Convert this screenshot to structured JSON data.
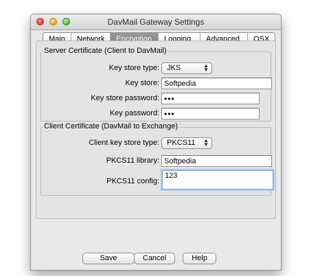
{
  "window": {
    "title": "DavMail Gateway Settings"
  },
  "tabs": [
    {
      "label": "Main",
      "active": false
    },
    {
      "label": "Network",
      "active": false
    },
    {
      "label": "Encryption",
      "active": true
    },
    {
      "label": "Logging",
      "active": false
    },
    {
      "label": "Advanced",
      "active": false
    },
    {
      "label": "OSX",
      "active": false
    }
  ],
  "server_cert": {
    "legend": "Server Certificate (Client to DavMail)",
    "key_store_type_label": "Key store type:",
    "key_store_type_value": "JKS",
    "key_store_label": "Key store:",
    "key_store_value": "Softpedia",
    "key_store_password_label": "Key store password:",
    "key_store_password_value": "•••",
    "key_password_label": "Key password:",
    "key_password_value": "•••"
  },
  "client_cert": {
    "legend": "Client Certificate (DavMail to Exchange)",
    "client_key_store_type_label": "Client key store type:",
    "client_key_store_type_value": "PKCS11",
    "pkcs11_library_label": "PKCS11 library:",
    "pkcs11_library_value": "Softpedia",
    "pkcs11_config_label": "PKCS11 config:",
    "pkcs11_config_value": "123"
  },
  "buttons": {
    "save": "Save",
    "cancel": "Cancel",
    "help": "Help"
  },
  "icons": {
    "popup_arrows": "updown-arrows-icon"
  },
  "colors": {
    "active_tab": "#8a8a8a",
    "focus_ring": "#a9c7ef"
  }
}
